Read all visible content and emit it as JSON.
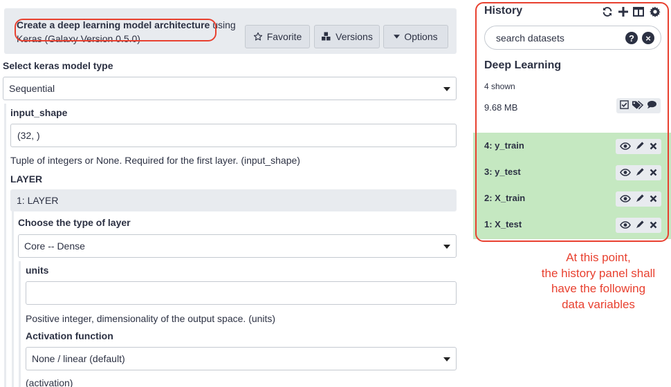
{
  "tool": {
    "title_bold": "Create a deep learning model architecture",
    "title_rest": " using Keras (Galaxy Version 0.5.0)",
    "buttons": {
      "favorite": "Favorite",
      "versions": "Versions",
      "options": "Options"
    }
  },
  "form": {
    "model_type_label": "Select keras model type",
    "model_type_value": "Sequential",
    "input_shape_label": "input_shape",
    "input_shape_value": "(32, )",
    "input_shape_help": "Tuple of integers or None. Required for the first layer. (input_shape)",
    "layer_label": "LAYER",
    "layer_section_title": "1: LAYER",
    "layer_type_label": "Choose the type of layer",
    "layer_type_value": "Core -- Dense",
    "units_label": "units",
    "units_value": "",
    "units_help": "Positive integer, dimensionality of the output space. (units)",
    "activation_label": "Activation function",
    "activation_value": "None / linear (default)",
    "activation_help": "(activation)"
  },
  "history": {
    "title": "History",
    "icons": [
      "refresh-icon",
      "plus-icon",
      "columns-icon",
      "gear-icon"
    ],
    "search_placeholder": "search datasets",
    "name": "Deep Learning",
    "shown": "4 shown",
    "size": "9.68 MB",
    "datasets": [
      {
        "label": "4: y_train"
      },
      {
        "label": "3: y_test"
      },
      {
        "label": "2: X_train"
      },
      {
        "label": "1: X_test"
      }
    ],
    "dataset_ok_color": "#c5e8c1"
  },
  "annotation": {
    "lines": [
      "At this point,",
      "the history panel shall",
      "have the following",
      "data variables"
    ],
    "color": "#e8402f"
  }
}
